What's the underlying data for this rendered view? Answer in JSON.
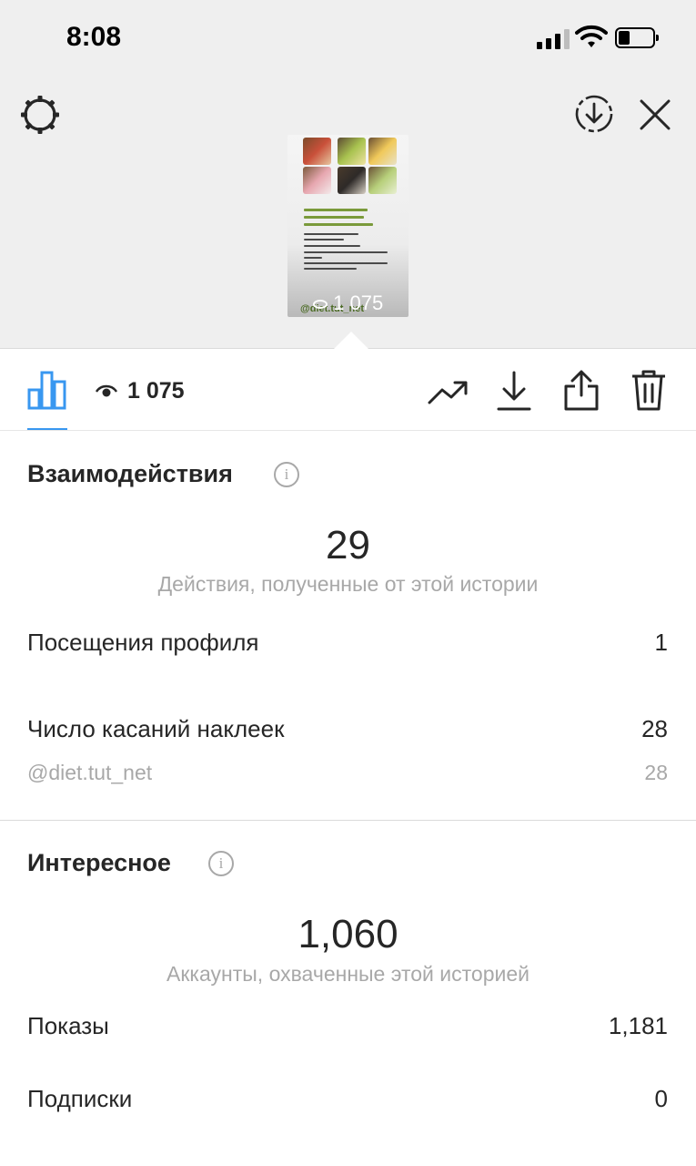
{
  "status_bar": {
    "time": "8:08"
  },
  "story": {
    "thumbnail_lines": [
      "ПП РЕЦЕПТЫ",
      "ТОП ПЕРЕКУСОВ",
      "ГОТОВЫЕ МЕНЮШКИ..."
    ],
    "thumbnail_bullets": [
      "Что такое здоровое питание...",
      "Целлюлитные истории",
      "Рецепты для всей семьи за 10 мин",
      "Реально ли похудеть без диет и голодовок"
    ],
    "thumbnail_handle": "@diet.tut_net",
    "thumbnail_views": "1 075"
  },
  "toolbar": {
    "views": "1 075"
  },
  "interactions": {
    "title": "Взаимодействия",
    "total": "29",
    "total_caption": "Действия, полученные от этой истории",
    "rows": [
      {
        "label": "Посещения профиля",
        "value": "1"
      },
      {
        "label": "Число касаний наклеек",
        "value": "28"
      },
      {
        "label": "@diet.tut_net",
        "value": "28"
      }
    ]
  },
  "discovery": {
    "title": "Интересное",
    "total": "1,060",
    "total_caption": "Аккаунты, охваченные этой историей",
    "rows": [
      {
        "label": "Показы",
        "value": "1,181"
      },
      {
        "label": "Подписки",
        "value": "0"
      }
    ]
  },
  "icons": [
    "gear-icon",
    "download-circle-icon",
    "close-icon",
    "insights-bar-chart-icon",
    "eye-icon",
    "trend-icon",
    "download-icon",
    "share-icon",
    "trash-icon",
    "info-icon"
  ],
  "colors": {
    "accent": "#3897f0",
    "muted": "#a8a8a8",
    "text": "#262626"
  }
}
